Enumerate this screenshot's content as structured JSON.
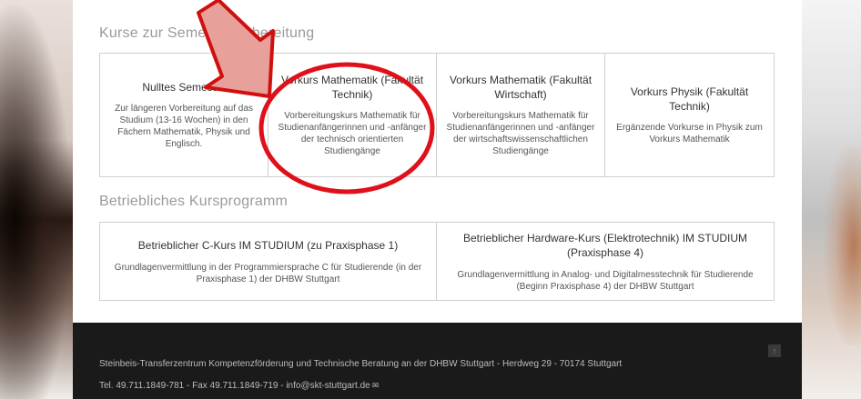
{
  "sections": {
    "semester": {
      "title": "Kurse zur Semestervorbereitung",
      "courses": [
        {
          "title": "Nulltes Semester",
          "description": "Zur längeren Vorbereitung auf das Studium (13-16 Wochen) in den Fächern Mathematik, Physik und Englisch."
        },
        {
          "title": "Vorkurs Mathematik (Fakultät Technik)",
          "description": "Vorbereitungskurs Mathematik für Studienanfängerinnen und -anfänger der technisch orientierten Studiengänge"
        },
        {
          "title": "Vorkurs Mathematik (Fakultät Wirtschaft)",
          "description": "Vorbereitungskurs Mathematik für Studienanfängerinnen und -anfänger der wirtschaftswissenschaftlichen Studiengänge"
        },
        {
          "title": "Vorkurs Physik (Fakultät Technik)",
          "description": "Ergänzende Vorkurse in Physik zum Vorkurs Mathematik"
        }
      ]
    },
    "betrieblich": {
      "title": "Betriebliches Kursprogramm",
      "courses": [
        {
          "title": "Betrieblicher C-Kurs IM STUDIUM (zu Praxisphase 1)",
          "description": "Grundlagenvermittlung in der Programmiersprache C für Studierende (in der Praxisphase 1) der DHBW Stuttgart"
        },
        {
          "title": "Betrieblicher Hardware-Kurs (Elektrotechnik) IM STUDIUM (Praxisphase 4)",
          "description": "Grundlagenvermittlung in Analog- und Digitalmesstechnik für Studierende (Beginn Praxisphase 4) der DHBW Stuttgart"
        }
      ]
    }
  },
  "footer": {
    "address": "Steinbeis-Transferzentrum Kompetenzförderung und Technische Beratung an der DHBW Stuttgart - Herdweg 29 - 70174 Stuttgart",
    "contact": "Tel. 49.711.1849-781 - Fax 49.711.1849-719 - info@skt-stuttgart.de",
    "mail_icon": "✉",
    "top_button_icon": "↑"
  },
  "annotation": {
    "arrow_color": "#e8a09a",
    "circle_color": "#e0101a"
  }
}
